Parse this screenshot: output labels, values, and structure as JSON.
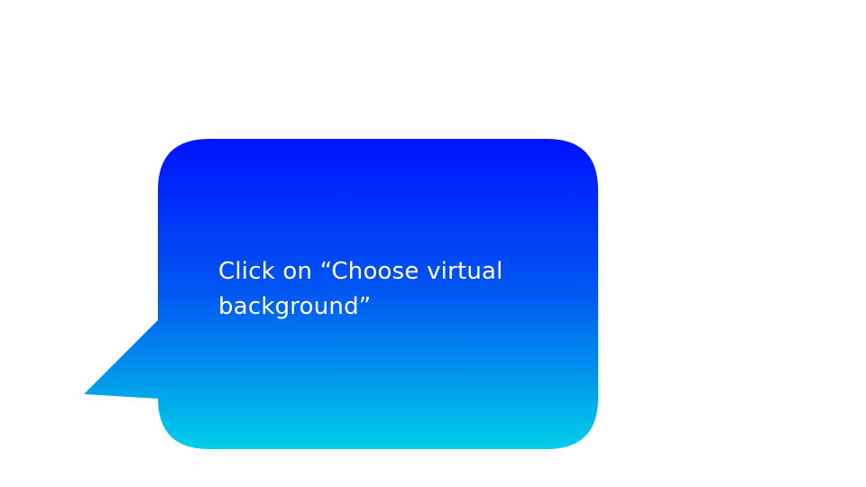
{
  "callout": {
    "text": "Click on “Choose virtual background”",
    "gradient_top": "#0012ff",
    "gradient_mid": "#0058f2",
    "gradient_bottom": "#00cfe8",
    "text_color": "#ffffff"
  }
}
